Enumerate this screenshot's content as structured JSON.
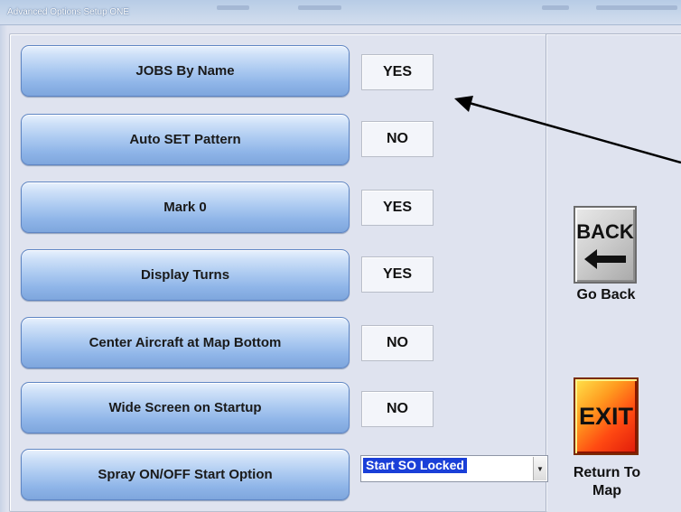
{
  "window": {
    "title": "Advanced Options Setup ONE"
  },
  "options": [
    {
      "label": "JOBS By Name",
      "value": "YES"
    },
    {
      "label": "Auto SET Pattern",
      "value": "NO"
    },
    {
      "label": "Mark 0",
      "value": "YES"
    },
    {
      "label": "Display Turns",
      "value": "YES"
    },
    {
      "label": "Center Aircraft at Map Bottom",
      "value": "NO"
    },
    {
      "label": "Wide Screen on Startup",
      "value": "NO"
    },
    {
      "label": "Spray ON/OFF Start Option"
    }
  ],
  "spray_start": {
    "selected": "Start SO Locked"
  },
  "back": {
    "icon_text": "BACK",
    "icon": "left-arrow-icon",
    "label": "Go Back"
  },
  "exit": {
    "icon_text": "EXIT",
    "label_line1": "Return To",
    "label_line2": "Map"
  },
  "colors": {
    "button_blue": "#a9c8f0",
    "exit_orange": "#ff4a12",
    "selection_blue": "#1a3fd8"
  }
}
